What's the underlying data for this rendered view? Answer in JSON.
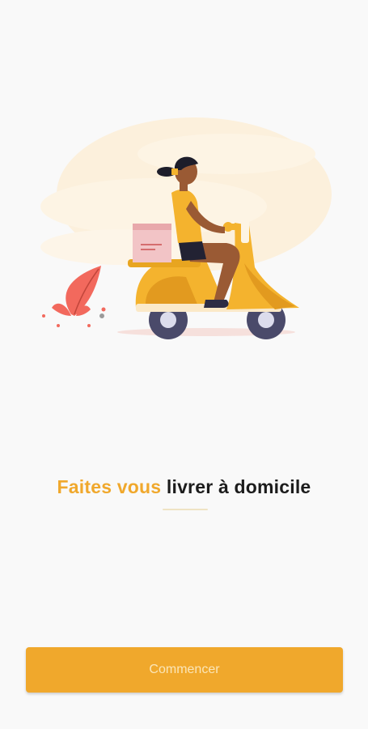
{
  "colors": {
    "accent": "#f0a82c",
    "dark_text": "#1c1c1c",
    "background": "#f9f9f9"
  },
  "onboarding": {
    "illustration": "woman-riding-delivery-scooter",
    "headline_accent": "Faites vous",
    "headline_rest": " livrer à domicile",
    "start_button_label": "Commencer"
  }
}
